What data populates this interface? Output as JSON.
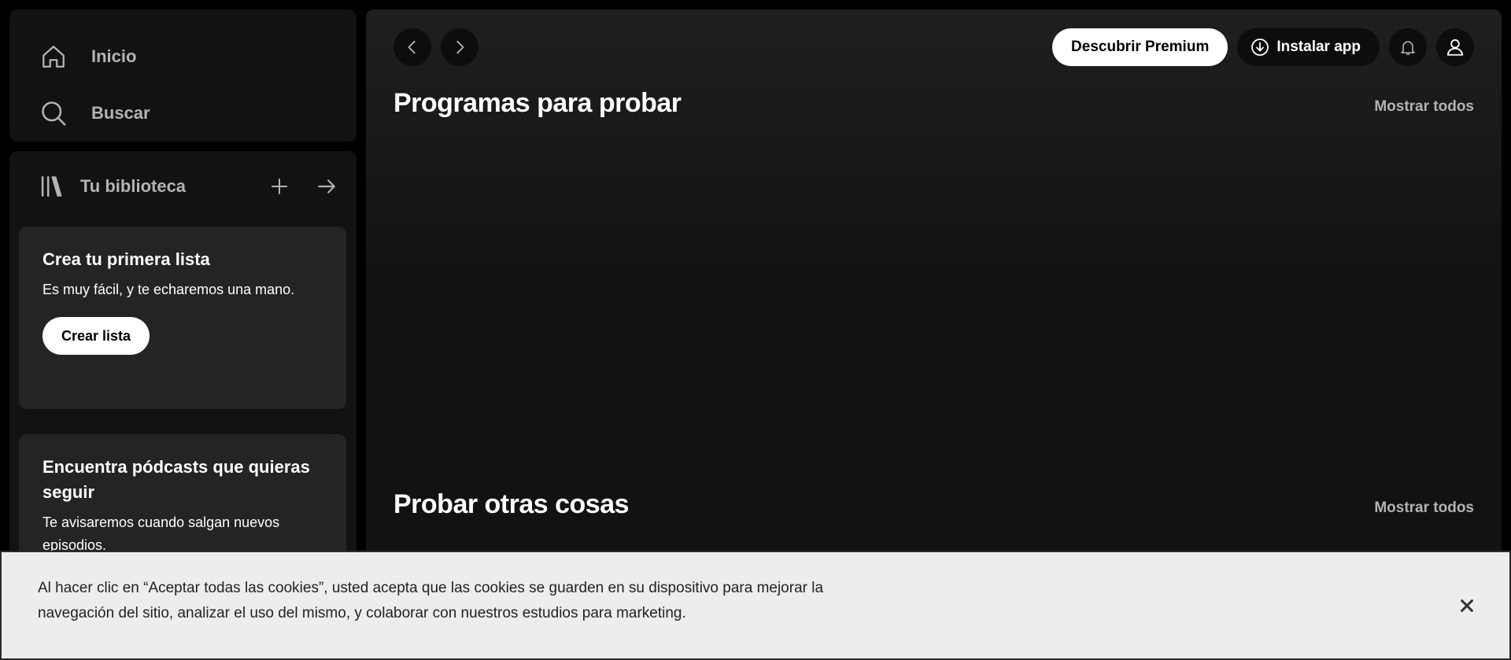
{
  "sidebar": {
    "nav": [
      {
        "label": "Inicio",
        "icon": "home-icon"
      },
      {
        "label": "Buscar",
        "icon": "search-icon"
      }
    ],
    "library": {
      "title": "Tu biblioteca",
      "icons": [
        "library-icon",
        "plus-icon",
        "arrow-right-icon"
      ]
    },
    "promos": [
      {
        "title": "Crea tu primera lista",
        "text": "Es muy fácil, y te echaremos una mano.",
        "button": "Crear lista"
      },
      {
        "title": "Encuentra pódcasts que quieras seguir",
        "text": "Te avisaremos cuando salgan nuevos episodios."
      }
    ]
  },
  "header": {
    "premium_label": "Descubrir Premium",
    "install_label": "Instalar app"
  },
  "main": {
    "sections": [
      {
        "title": "Programas para probar",
        "show_all": "Mostrar todos"
      },
      {
        "title": "Probar otras cosas",
        "show_all": "Mostrar todos"
      }
    ]
  },
  "cookie_banner": {
    "text": "Al hacer clic en “Aceptar todas las cookies”, usted acepta que las cookies se guarden en su dispositivo para mejorar la navegación del sitio, analizar el uso del mismo, y colaborar con nuestros estudios para marketing."
  },
  "colors": {
    "background": "#000000",
    "panel": "#121212",
    "card": "#242424",
    "muted_text": "#b3b3b3",
    "banner": "#ededed"
  }
}
